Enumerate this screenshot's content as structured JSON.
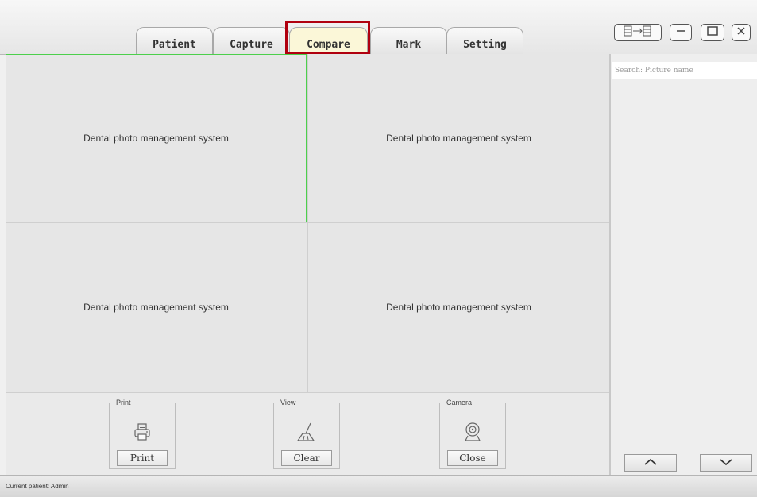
{
  "tabs": [
    {
      "label": "Patient",
      "active": false
    },
    {
      "label": "Capture",
      "active": false
    },
    {
      "label": "Compare",
      "active": true
    },
    {
      "label": "Mark",
      "active": false
    },
    {
      "label": "Setting",
      "active": false
    }
  ],
  "window_controls": {
    "layout_icon": "panel-arrow-icon",
    "minimize_icon": "minimize-icon",
    "maximize_icon": "maximize-icon",
    "close_icon": "close-icon"
  },
  "grid": {
    "cells": [
      {
        "text": "Dental photo management system",
        "selected": true
      },
      {
        "text": "Dental photo management system",
        "selected": false
      },
      {
        "text": "Dental photo management system",
        "selected": false
      },
      {
        "text": "Dental photo management system",
        "selected": false
      }
    ]
  },
  "toolbar": {
    "print": {
      "legend": "Print",
      "button": "Print",
      "icon": "printer-icon"
    },
    "view": {
      "legend": "View",
      "button": "Clear",
      "icon": "broom-icon"
    },
    "camera": {
      "legend": "Camera",
      "button": "Close",
      "icon": "webcam-icon"
    }
  },
  "search": {
    "placeholder": "Search: Picture name",
    "value": ""
  },
  "nav": {
    "up_icon": "chevron-up-icon",
    "down_icon": "chevron-down-icon"
  },
  "status": {
    "text": "Current patient: Admin"
  },
  "colors": {
    "active_tab": "#fbf7d8",
    "highlight": "#b0000f",
    "selected_cell": "#4cd04c"
  }
}
